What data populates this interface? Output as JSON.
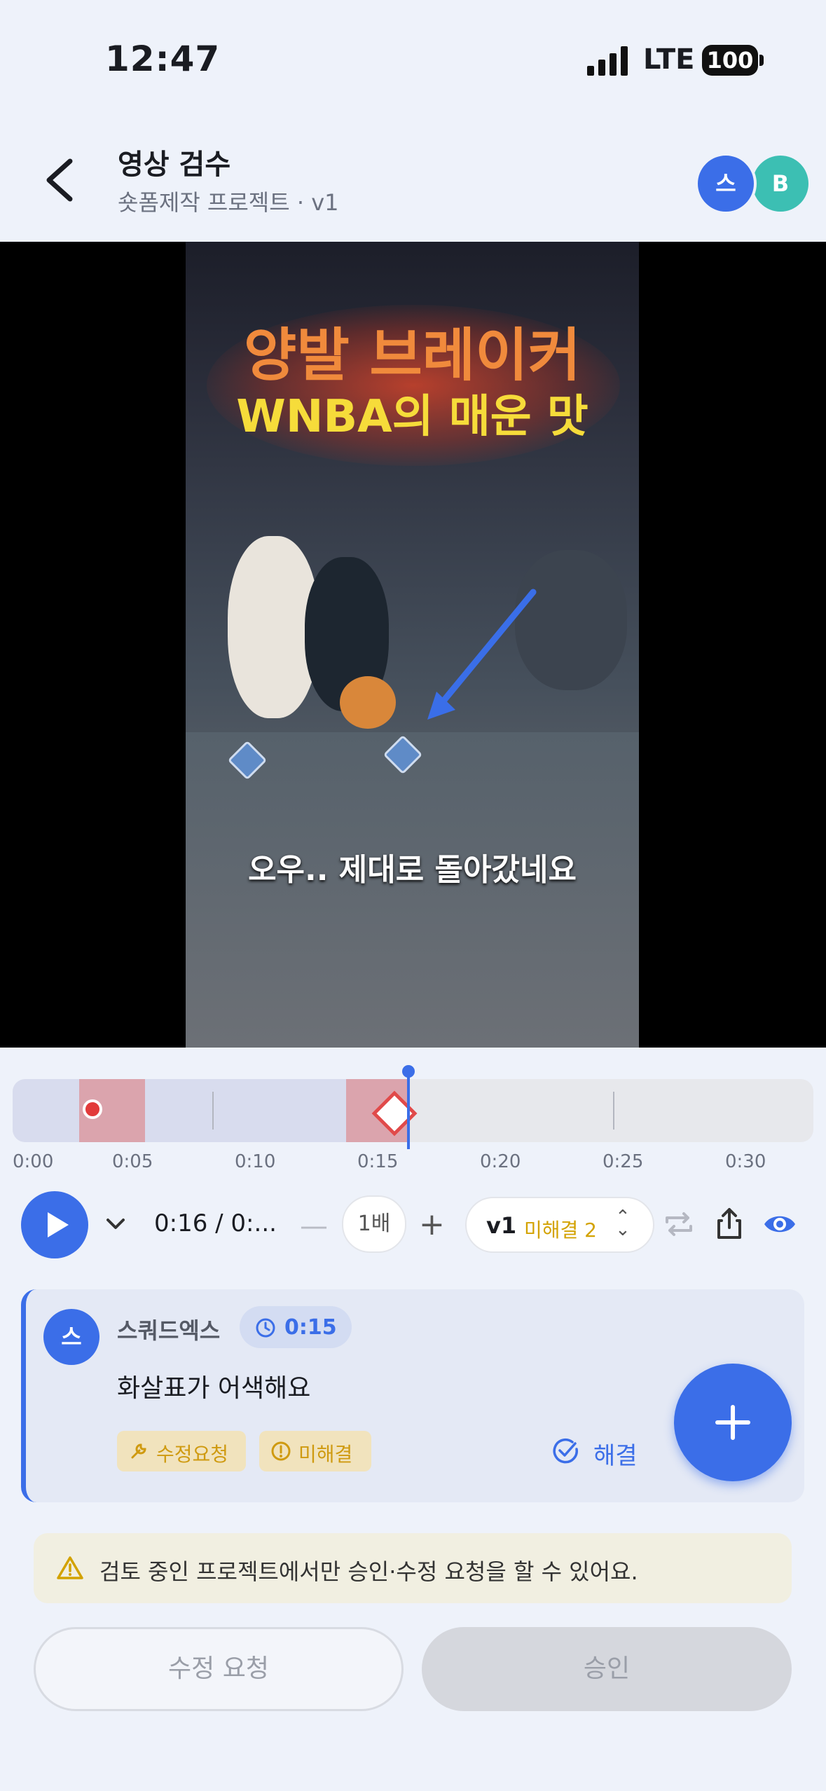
{
  "status_bar": {
    "time": "12:47",
    "network": "LTE",
    "battery": "100"
  },
  "header": {
    "title": "영상 검수",
    "subtitle": "숏폼제작 프로젝트 · v1",
    "avatars": [
      "스",
      "B"
    ]
  },
  "video": {
    "caption_line1": "양발 브레이커",
    "caption_line2": "WNBA의 매운 맛",
    "subtitle": "오우.. 제대로 돌아갔네요",
    "arrow_color": "#3a6ee8"
  },
  "timeline": {
    "labels": [
      "0:00",
      "0:05",
      "0:10",
      "0:15",
      "0:20",
      "0:25",
      "0:30"
    ],
    "playhead_seconds": 16,
    "duration_seconds": 33.5
  },
  "controls": {
    "current_time": "0:16 / 0:...",
    "speed": "1배",
    "version": "v1",
    "unresolved": "미해결 2"
  },
  "comment": {
    "avatar": "스",
    "author": "스쿼드엑스",
    "timestamp": "0:15",
    "text": "화살표가 어색해요",
    "tag_revision": "수정요청",
    "tag_status": "미해결",
    "resolve_label": "해결"
  },
  "notice": "검토 중인 프로젝트에서만 승인·수정 요청을 할 수 있어요.",
  "actions": {
    "request_revision": "수정 요청",
    "approve": "승인"
  },
  "colors": {
    "accent": "#3b6ee8",
    "warning": "#d3a200",
    "marker_red": "#e04a4a"
  }
}
